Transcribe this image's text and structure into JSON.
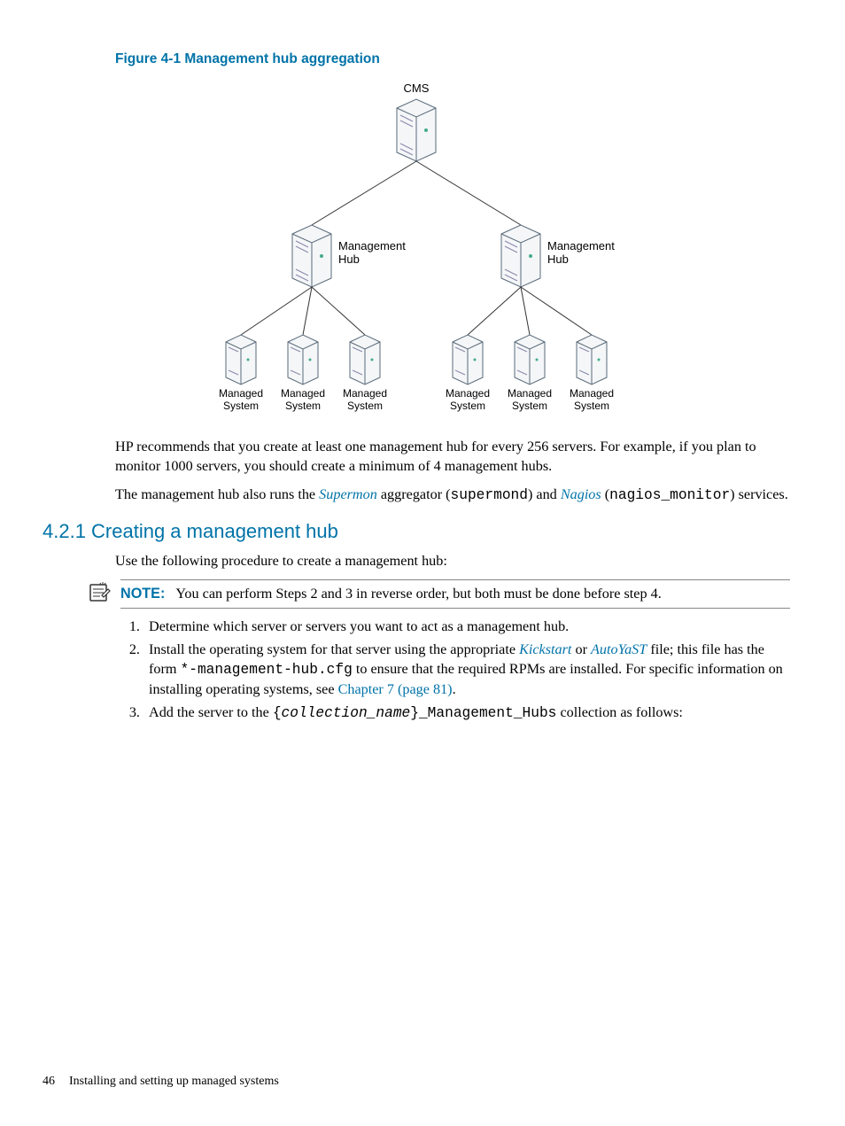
{
  "figure": {
    "caption": "Figure 4-1 Management hub aggregation",
    "labels": {
      "cms": "CMS",
      "hub": "Management\nHub",
      "managed": "Managed\nSystem"
    }
  },
  "paragraph1": "HP recommends that you create at least one management hub for every 256 servers. For example, if you plan to monitor 1000 servers, you should create a minimum of 4 management hubs.",
  "paragraph2_a": "The management hub also runs the ",
  "paragraph2_supermon": "Supermon",
  "paragraph2_b": " aggregator (",
  "paragraph2_supermond": "supermond",
  "paragraph2_c": ") and ",
  "paragraph2_nagios": "Nagios",
  "paragraph2_d": " (",
  "paragraph2_nagiosmon": "nagios_monitor",
  "paragraph2_e": ") services.",
  "section_heading": "4.2.1 Creating a management hub",
  "intro": "Use the following procedure to create a management hub:",
  "note": {
    "label": "NOTE:",
    "text": "You can perform Steps 2 and 3 in reverse order, but both must be done before step 4."
  },
  "steps": {
    "s1": "Determine which server or servers you want to act as a management hub.",
    "s2_a": "Install the operating system for that server using the appropriate ",
    "s2_kick": "Kickstart",
    "s2_b": " or ",
    "s2_auto": "AutoYaST",
    "s2_c": " file; this file has the form ",
    "s2_code": "*-management-hub.cfg",
    "s2_d": " to ensure that the required RPMs are installed. For specific information on installing operating systems, see ",
    "s2_link": "Chapter 7 (page 81)",
    "s2_e": ".",
    "s3_a": "Add the server to the ",
    "s3_brace_open": "{",
    "s3_var": "collection_name",
    "s3_brace_close": "}",
    "s3_suffix": "_Management_Hubs",
    "s3_b": " collection as follows:"
  },
  "footer": {
    "page": "46",
    "title": "Installing and setting up managed systems"
  }
}
